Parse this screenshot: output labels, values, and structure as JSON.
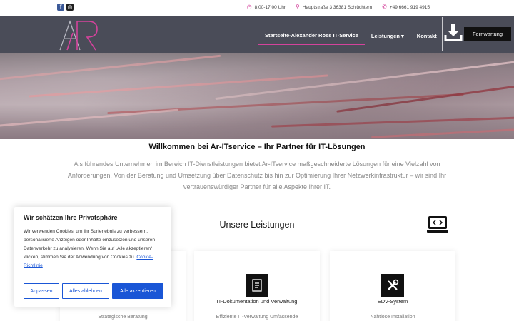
{
  "topbar": {
    "social": [
      {
        "icon": "facebook-icon",
        "glyph": "f"
      },
      {
        "icon": "instagram-icon",
        "glyph": "◎"
      }
    ],
    "hours": "8:00-17:00 Uhr",
    "address": "Hauptstraße 3 36381 Schlüchtern",
    "phone": "+49 6661 919 4915"
  },
  "nav": {
    "items": [
      {
        "label": "Startseite-Alexander Ross IT-Service",
        "active": true
      },
      {
        "label": "Leistungen",
        "has_dropdown": true,
        "caret": "▾"
      },
      {
        "label": "Kontakt"
      }
    ],
    "cta_label": "Fernwartung"
  },
  "welcome": {
    "title": "Willkommen bei Ar-ITservice – Ihr Partner für IT-Lösungen",
    "text": "Als führendes Unternehmen im Bereich IT-Dienstleistungen bietet Ar-ITservice maßgeschneiderte Lösungen für eine Vielzahl von Anforderungen. Von der Beratung und Umsetzung über Datenschutz bis hin zur Optimierung Ihrer Netzwerkinfrastruktur – wir sind Ihr vertrauenswürdiger Partner für alle Aspekte Ihrer IT."
  },
  "services": {
    "title": "Unsere Leistungen",
    "cards": [
      {
        "title": "",
        "subtitle": "Strategische Beratung",
        "icon": "strategy-icon"
      },
      {
        "title": "IT-Dokumentation und Verwaltung",
        "subtitle": "Effiziente IT-Verwaltung Umfassende",
        "icon": "document-icon"
      },
      {
        "title": "EDV-System",
        "subtitle": "Nahtlose Installation",
        "icon": "tools-icon"
      }
    ]
  },
  "cookie": {
    "title": "Wir schätzen Ihre Privatsphäre",
    "text": "Wir verwenden Cookies, um Ihr Surferlebnis zu verbessern, personalisierte Anzeigen oder Inhalte einzusetzen und unseren Datenverkehr zu analysieren. Wenn Sie auf „Alle akzeptieren“ klicken, stimmen Sie der Anwendung von Cookies zu.",
    "link": "Cookie-Richtlinie",
    "buttons": {
      "customize": "Anpassen",
      "reject": "Alles ablehnen",
      "accept": "Alle akzeptieren"
    }
  },
  "colors": {
    "accent": "#d4439c",
    "navbar": "#4a4c58",
    "button_blue": "#1a56d6"
  }
}
